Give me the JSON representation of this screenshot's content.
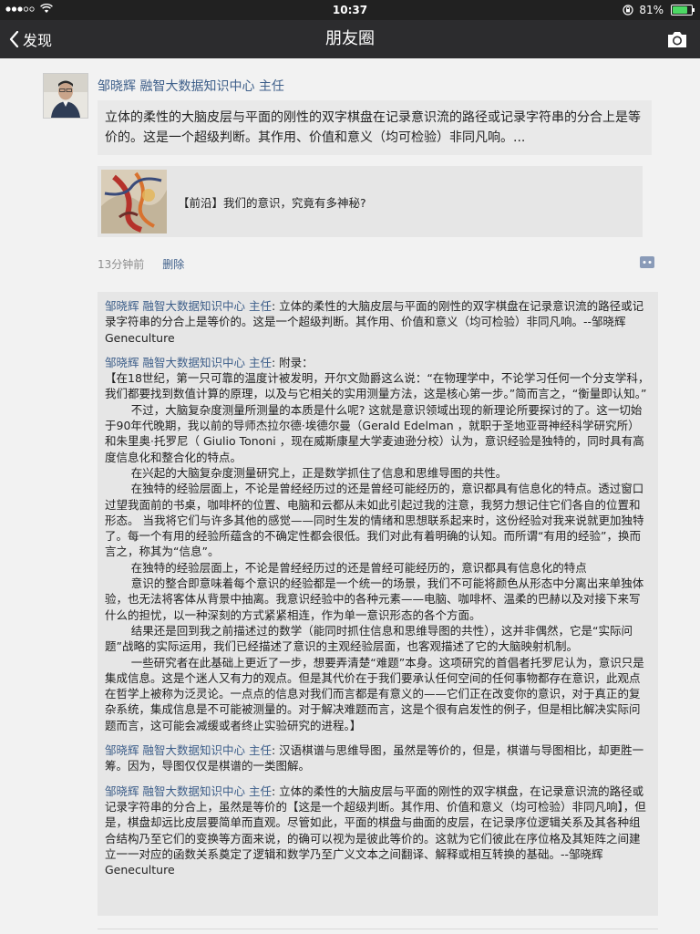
{
  "status_bar": {
    "time": "10:37",
    "battery": "81%"
  },
  "nav": {
    "back_label": "发现",
    "title": "朋友圈"
  },
  "post": {
    "author": "邹晓辉 融智大数据知识中心 主任",
    "text": "立体的柔性的大脑皮层与平面的刚性的双字棋盘在记录意识流的路径或记录字符串的分合上是等价的。这是一个超级判断。其作用、价值和意义（均可检验）非同凡响。...",
    "share_title": "【前沿】我们的意识，究竟有多神秘?",
    "time_ago": "13分钟前",
    "delete_label": "删除"
  },
  "comments": [
    {
      "name": "邹晓辉 融智大数据知识中心 主任",
      "sep": ": ",
      "paragraphs": [
        "立体的柔性的大脑皮层与平面的刚性的双字棋盘在记录意识流的路径或记录字符串的分合上是等价的。这是一个超级判断。其作用、价值和意义（均可检验）非同凡响。--邹晓辉Geneculture"
      ]
    },
    {
      "name": "邹晓辉 融智大数据知识中心 主任",
      "sep": ": ",
      "paragraphs": [
        "附录：",
        "【在18世纪，第一只可靠的温度计被发明，开尔文勋爵这么说：“在物理学中，不论学习任何一个分支学科，我们都要找到数值计算的原理，以及与它相关的实用测量方法，这是核心第一步。”简而言之，“衡量即认知。”",
        "不过，大脑复杂度测量所测量的本质是什么呢? 这就是意识领域出现的新理论所要探讨的了。这一切始于90年代晚期，我以前的导师杰拉尔德·埃德尔曼（Gerald Edelman ，就职于圣地亚哥神经科学研究所）和朱里奥·托罗尼（ Giulio Tononi ，现在威斯康星大学麦迪逊分校）认为，意识经验是独特的，同时具有高度信息化和整合化的特点。",
        "在兴起的大脑复杂度测量研究上，正是数学抓住了信息和思维导图的共性。",
        "在独特的经验层面上，不论是曾经经历过的还是曾经可能经历的，意识都具有信息化的特点。透过窗口过望我面前的书桌，咖啡杯的位置、电脑和云都从未如此引起过我的注意，我努力想记住它们各自的位置和形态。 当我将它们与许多其他的感觉——同时生发的情绪和思想联系起来时，这份经验对我来说就更加独特了。每一个有用的经验所蕴含的不确定性都会很低。我们对此有着明确的认知。而所谓“有用的经验”，换而言之，称其为“信息”。",
        "在独特的经验层面上，不论是曾经经历过的还是曾经可能经历的，意识都具有信息化的特点",
        "意识的整合即意味着每个意识的经验都是一个统一的场景，我们不可能将颜色从形态中分离出来单独体验，也无法将客体从背景中抽离。我意识经验中的各种元素——电脑、咖啡杯、温柔的巴赫以及对接下来写什么的担忧，以一种深刻的方式紧紧相连，作为单一意识形态的各个方面。",
        "结果还是回到我之前描述过的数学（能同时抓住信息和思维导图的共性），这并非偶然，它是“实际问题”战略的实际运用，我们已经描述了意识的主观经验层面，也客观描述了它的大脑映射机制。",
        "一些研究者在此基础上更近了一步，想要弄清楚“难题”本身。这项研究的首倡者托罗尼认为，意识只是集成信息。这是个迷人又有力的观点。但是其代价在于我们要承认任何空间的任何事物都存在意识，此观点在哲学上被称为泛灵论。一点点的信息对我们而言都是有意义的——它们正在改变你的意识，对于真正的复杂系统，集成信息是不可能被测量的。对于解决难题而言，这是个很有启发性的例子，但是相比解决实际问题而言，这可能会减缓或者终止实验研究的进程。】"
      ]
    },
    {
      "name": "邹晓辉 融智大数据知识中心 主任",
      "sep": ": ",
      "paragraphs": [
        "汉语棋谱与思维导图，虽然是等价的，但是，棋谱与导图相比，却更胜一筹。因为，导图仅仅是棋谱的一类图解。"
      ]
    },
    {
      "name": "邹晓辉 融智大数据知识中心 主任",
      "sep": ": ",
      "paragraphs": [
        "立体的柔性的大脑皮层与平面的刚性的双字棋盘，在记录意识流的路径或记录字符串的分合上，虽然是等价的【这是一个超级判断。其作用、价值和意义（均可检验）非同凡响】，但是，棋盘却远比皮层要简单而直观。尽管如此，平面的棋盘与曲面的皮层，在记录序位逻辑关系及其各种组合结构乃至它们的变换等方面来说，的确可以视为是彼此等价的。这就为它们彼此在序位格及其矩阵之间建立一一对应的函数关系奠定了逻辑和数学乃至广义文本之间翻译、解释或相互转换的基础。--邹晓辉Geneculture"
      ]
    }
  ],
  "icons": {
    "back": "chevron-left-icon",
    "camera": "camera-icon",
    "comment": "comment-action-icon",
    "wifi": "wifi-icon",
    "signal": "signal-dots-icon",
    "lock": "rotation-lock-icon",
    "battery": "battery-icon"
  },
  "colors": {
    "link": "#3e5f8a",
    "nav_bg": "#2c2c2e",
    "status_bg": "#212121",
    "battery_fill": "#4cd964"
  },
  "battery_level": 0.81
}
